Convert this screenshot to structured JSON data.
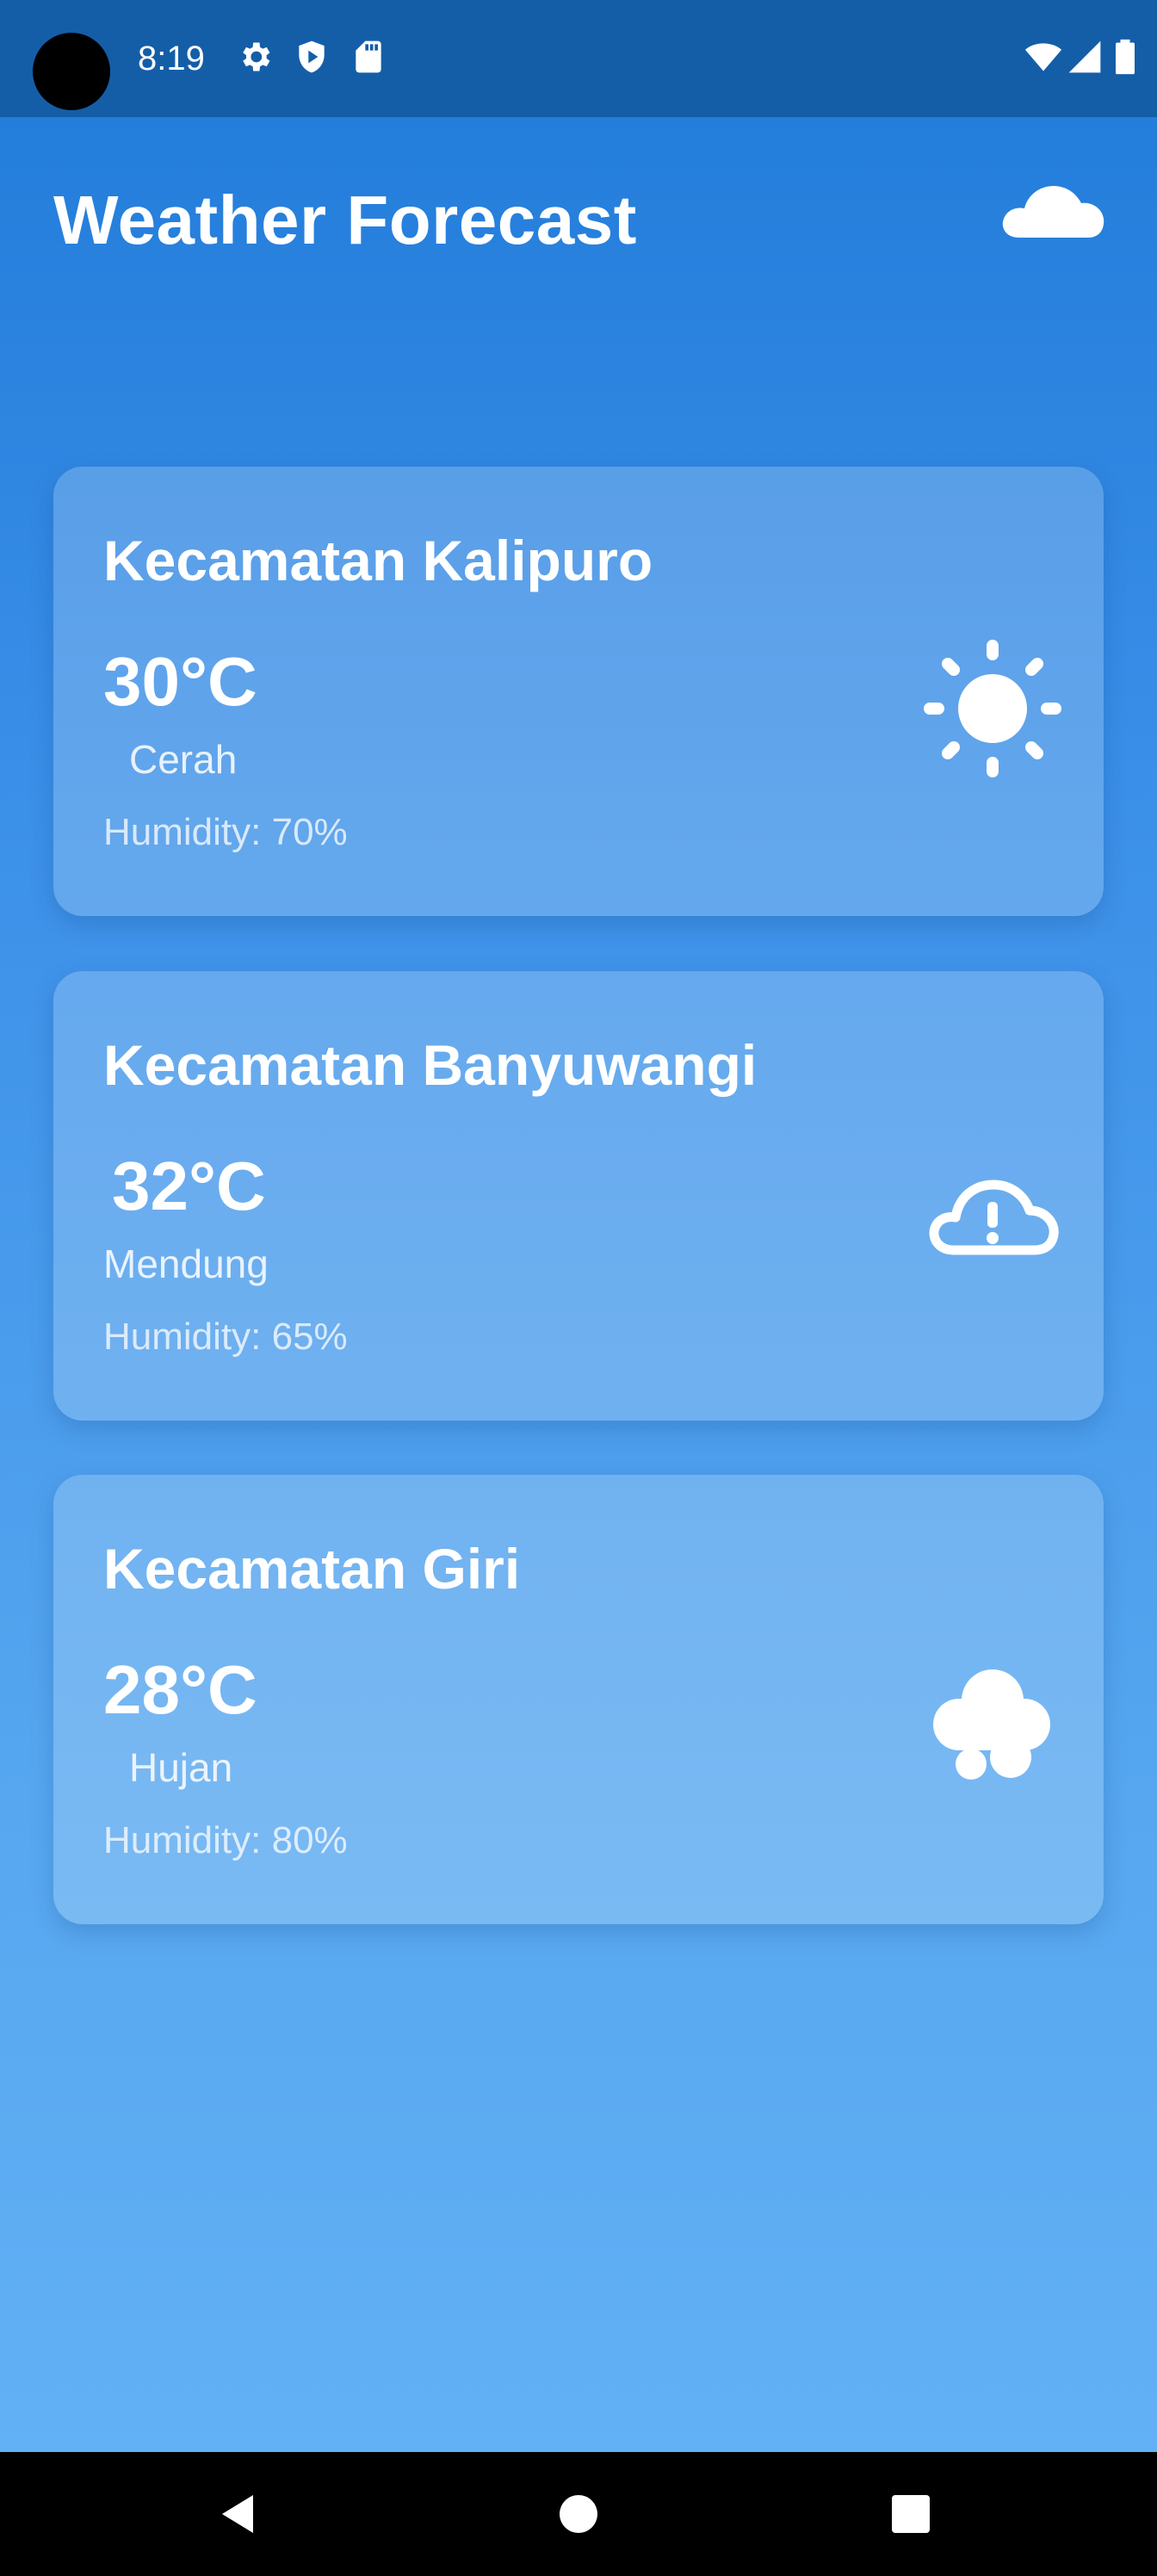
{
  "status_bar": {
    "time": "8:19",
    "icons_left": [
      "gear-icon",
      "shield-play-icon",
      "sd-card-icon"
    ],
    "icons_right": [
      "wifi-icon",
      "cell-signal-icon",
      "battery-icon"
    ]
  },
  "app": {
    "title": "Weather Forecast",
    "header_icon": "cloud-icon"
  },
  "cards": [
    {
      "location": "Kecamatan Kalipuro",
      "temperature": "30°C",
      "condition": "Cerah",
      "humidity": "Humidity: 70%",
      "icon": "sun-icon"
    },
    {
      "location": "Kecamatan Banyuwangi",
      "temperature": "32°C",
      "condition": "Mendung",
      "humidity": "Humidity: 65%",
      "icon": "cloud-alert-icon"
    },
    {
      "location": "Kecamatan Giri",
      "temperature": "28°C",
      "condition": "Hujan",
      "humidity": "Humidity: 80%",
      "icon": "rain-cloud-icon"
    }
  ],
  "nav_bar": {
    "buttons": [
      "back-icon",
      "home-icon",
      "recents-icon"
    ]
  },
  "colors": {
    "status_bar": "#145ea8",
    "gradient_top": "#1f7ad8",
    "gradient_bottom": "#64b2f6",
    "text": "#ffffff",
    "nav_bar": "#000000"
  }
}
